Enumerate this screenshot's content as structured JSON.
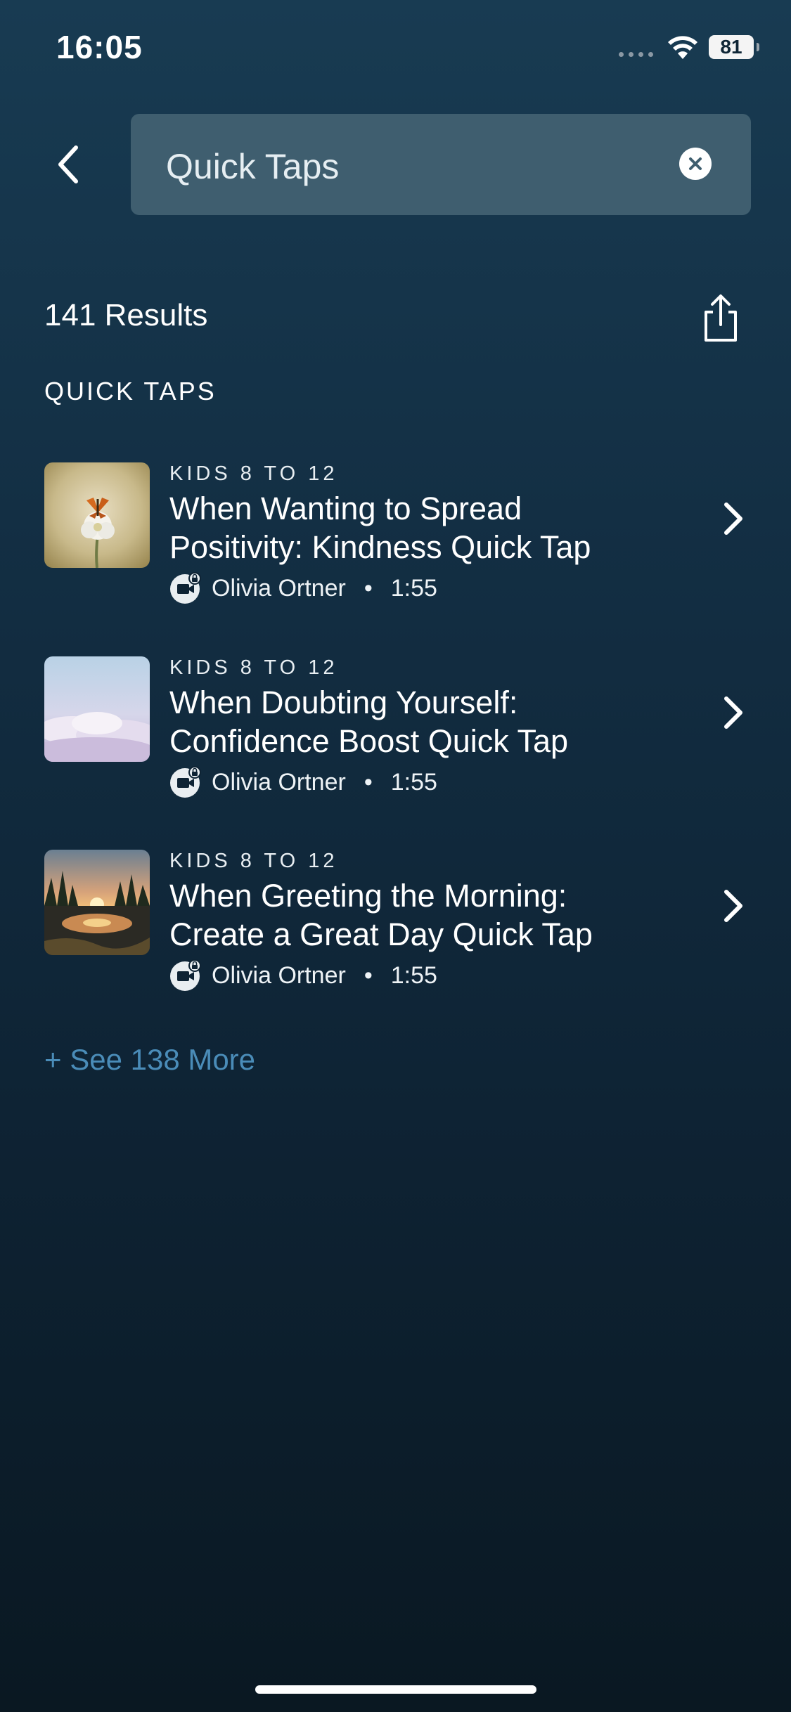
{
  "status_bar": {
    "time": "16:05",
    "battery": "81"
  },
  "search": {
    "query": "Quick Taps"
  },
  "results": {
    "count_label": "141 Results",
    "section_title": "QUICK TAPS"
  },
  "items": [
    {
      "category": "KIDS 8 TO 12",
      "title": "When Wanting to Spread Positivity: Kindness Quick Tap",
      "author": "Olivia Ortner",
      "duration": "1:55"
    },
    {
      "category": "KIDS 8 TO 12",
      "title": "When Doubting Yourself: Confidence Boost Quick Tap",
      "author": "Olivia Ortner",
      "duration": "1:55"
    },
    {
      "category": "KIDS 8 TO 12",
      "title": "When Greeting the Morning: Create a Great Day Quick Tap",
      "author": "Olivia Ortner",
      "duration": "1:55"
    }
  ],
  "see_more": "+ See 138 More",
  "colors": {
    "accent": "#4a8cb8",
    "search_bg": "#3f5e6f",
    "background_top": "#183b52",
    "background_bottom": "#0a1822"
  }
}
